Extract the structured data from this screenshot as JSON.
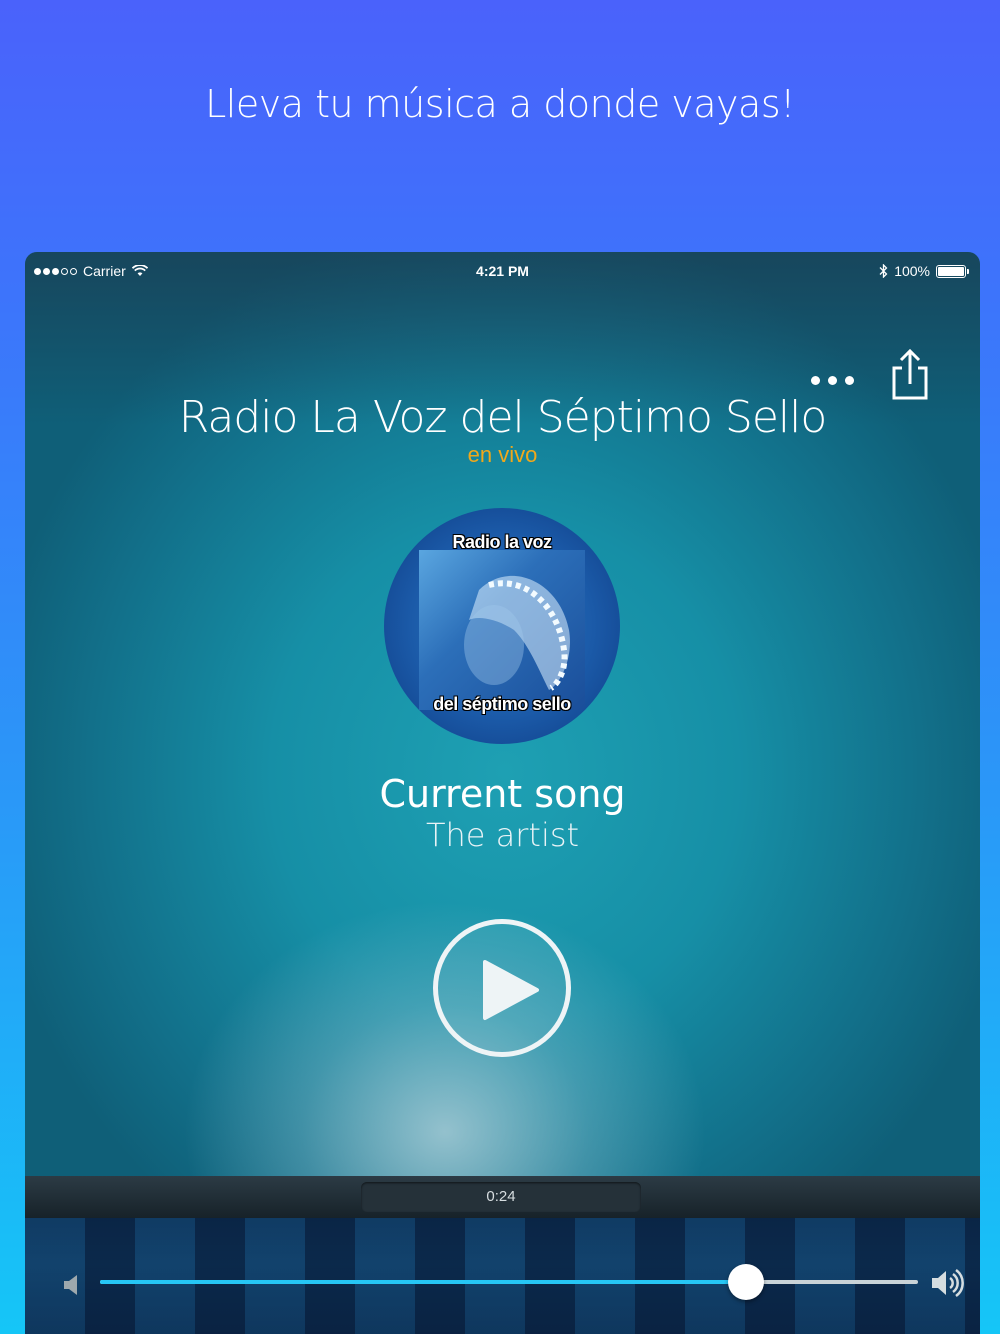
{
  "promo": {
    "headline": "Lleva tu música a donde vayas!"
  },
  "status_bar": {
    "carrier": "Carrier",
    "time": "4:21 PM",
    "battery": "100%"
  },
  "toolbar": {
    "more_icon": "more-dots-icon",
    "share_icon": "share-icon"
  },
  "station": {
    "title": "Radio La Voz del Séptimo Sello",
    "status": "en vivo"
  },
  "artwork": {
    "top_text": "Radio la voz",
    "bottom_text": "del séptimo sello"
  },
  "now_playing": {
    "song": "Current song",
    "artist": "The artist"
  },
  "player": {
    "play_icon": "play-icon",
    "elapsed": "0:24"
  },
  "volume": {
    "level": 0.79,
    "low_icon": "volume-low-icon",
    "high_icon": "volume-high-icon"
  },
  "colors": {
    "accent": "#26c6f5",
    "live": "#f0a81a"
  }
}
